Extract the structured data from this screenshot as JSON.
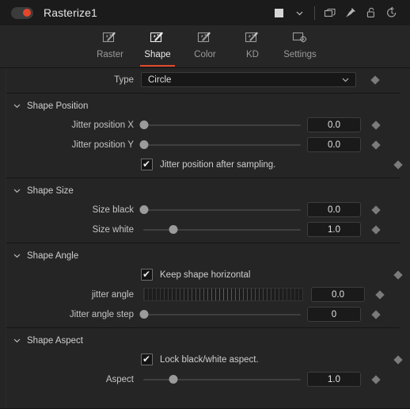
{
  "titlebar": {
    "node_enabled": true,
    "title": "Rasterize1",
    "toggle_color": "#e4472b",
    "swatch_color": "#d6d6d6",
    "icons": [
      {
        "name": "color-swatch",
        "label": "color-swatch"
      },
      {
        "name": "chevron-down-icon",
        "label": "chevron-down"
      },
      {
        "name": "duplicate-icon",
        "label": "duplicate"
      },
      {
        "name": "pin-icon",
        "label": "pin"
      },
      {
        "name": "lock-open-icon",
        "label": "lock-open"
      },
      {
        "name": "reset-icon",
        "label": "reset"
      }
    ]
  },
  "tabs": [
    {
      "label": "Raster",
      "icon": "magic-wand-icon",
      "active": false
    },
    {
      "label": "Shape",
      "icon": "magic-wand-icon",
      "active": true
    },
    {
      "label": "Color",
      "icon": "magic-wand-icon",
      "active": false
    },
    {
      "label": "KD",
      "icon": "magic-wand-icon",
      "active": false
    },
    {
      "label": "Settings",
      "icon": "gear-icon",
      "active": false
    }
  ],
  "accent_color": "#e4472b",
  "type_row": {
    "label": "Type",
    "value": "Circle"
  },
  "sections": [
    {
      "id": "shape-position",
      "title": "Shape Position",
      "expanded": true,
      "rows": [
        {
          "kind": "slider",
          "label": "Jitter position X",
          "value": "0.0",
          "pos": 2
        },
        {
          "kind": "slider",
          "label": "Jitter position Y",
          "value": "0.0",
          "pos": 2
        },
        {
          "kind": "checkbox",
          "label": "Jitter position after sampling.",
          "checked": true
        }
      ]
    },
    {
      "id": "shape-size",
      "title": "Shape Size",
      "expanded": true,
      "rows": [
        {
          "kind": "slider",
          "label": "Size black",
          "value": "0.0",
          "pos": 2
        },
        {
          "kind": "slider",
          "label": "Size white",
          "value": "1.0",
          "pos": 20
        }
      ]
    },
    {
      "id": "shape-angle",
      "title": "Shape Angle",
      "expanded": true,
      "rows": [
        {
          "kind": "checkbox",
          "label": "Keep shape horizontal",
          "checked": true
        },
        {
          "kind": "wheel",
          "label": "jitter angle",
          "value": "0.0"
        },
        {
          "kind": "slider",
          "label": "Jitter angle step",
          "value": "0",
          "pos": 2
        }
      ]
    },
    {
      "id": "shape-aspect",
      "title": "Shape Aspect",
      "expanded": true,
      "rows": [
        {
          "kind": "checkbox",
          "label": "Lock black/white aspect.",
          "checked": true
        },
        {
          "kind": "slider",
          "label": "Aspect",
          "value": "1.0",
          "pos": 20
        }
      ]
    }
  ],
  "keyframe_icon": "diamond-keyframe-icon",
  "checkbox_tick": "✔"
}
